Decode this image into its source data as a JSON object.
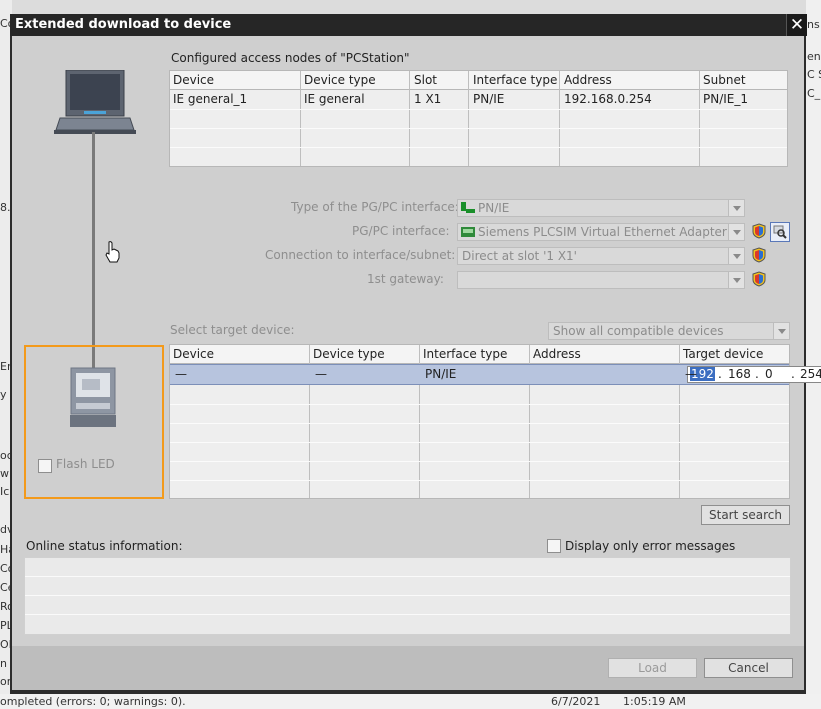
{
  "background": {
    "left_fragments": [
      "Co",
      "8.",
      "Er",
      "y a",
      "oc",
      "w",
      "Ic",
      "dv",
      "Ha",
      "Co",
      "Ce",
      "Ro",
      "PL",
      "OF",
      "n",
      "or"
    ],
    "right_fragments": [
      "ns",
      "end",
      "C S",
      "C_1"
    ],
    "status_message": "ompleted (errors: 0; warnings: 0).",
    "status_date": "6/7/2021",
    "status_time": "1:05:19 AM"
  },
  "dialog": {
    "title": "Extended download to device",
    "close_glyph": "✕",
    "access_nodes_title": "Configured access nodes of \"PCStation\"",
    "access_nodes_table": {
      "columns": [
        "Device",
        "Device type",
        "Slot",
        "Interface type",
        "Address",
        "Subnet"
      ],
      "rows": [
        [
          "IE general_1",
          "IE general",
          "1 X1",
          "PN/IE",
          "192.168.0.254",
          "PN/IE_1"
        ]
      ]
    },
    "settings": {
      "pgpc_type_label": "Type of the PG/PC interface:",
      "pgpc_type_value": "PN/IE",
      "pgpc_interface_label": "PG/PC interface:",
      "pgpc_interface_value": "Siemens PLCSIM Virtual Ethernet Adapter",
      "connection_label": "Connection to interface/subnet:",
      "connection_value": "Direct at slot '1 X1'",
      "gateway_label": "1st gateway:",
      "gateway_value": ""
    },
    "target": {
      "label": "Select target device:",
      "filter_value": "Show all compatible devices",
      "columns": [
        "Device",
        "Device type",
        "Interface type",
        "Address",
        "Target device"
      ],
      "row": {
        "device": "—",
        "device_type": "—",
        "interface_type": "PN/IE",
        "address_parts": [
          "192",
          "168",
          "0",
          "254"
        ],
        "target_device": "—"
      }
    },
    "flash_led_label": "Flash LED",
    "start_search_label": "Start search",
    "online_status_label": "Online status information:",
    "display_errors_label": "Display only error messages",
    "load_label": "Load",
    "cancel_label": "Cancel",
    "colors": {
      "accent_orange": "#f39a1b",
      "selection": "#b7c4de",
      "titlebar": "#262626"
    }
  }
}
